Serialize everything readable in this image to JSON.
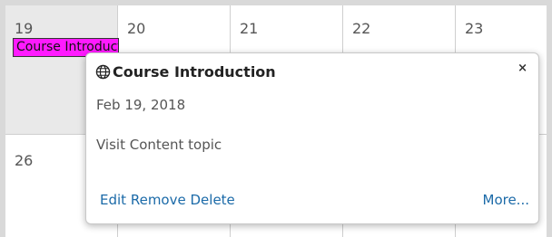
{
  "calendar": {
    "week1": [
      "19",
      "20",
      "21",
      "22",
      "23"
    ],
    "week2": [
      "26"
    ],
    "event_chip_label": "Course Introduction",
    "event_chip_color": "#ff1aff"
  },
  "popup": {
    "icon": "globe-icon",
    "title": "Course Introduction",
    "date": "Feb 19, 2018",
    "description": "Visit Content topic",
    "close_label": "×",
    "actions": {
      "edit": "Edit",
      "remove": "Remove",
      "delete": "Delete",
      "more": "More..."
    },
    "link_color": "#1b6aa8"
  }
}
